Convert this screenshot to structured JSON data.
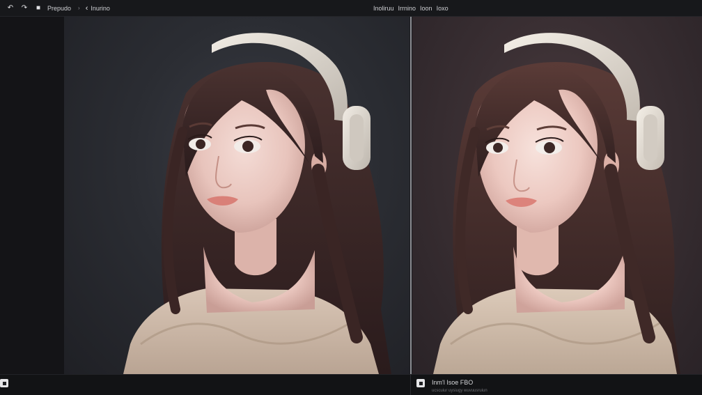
{
  "toolbar": {
    "left_label": "Prepudo",
    "separator": "›",
    "back_glyph": "‹",
    "crumb": "Inurino",
    "center_items": [
      "Inoliruu",
      "Irrnino",
      "Ioon",
      "Ioxo"
    ],
    "icons": [
      "undo-icon",
      "redo-icon",
      "layers-icon"
    ]
  },
  "statusbar": {
    "right_status": "Inm'l Isoe FBO",
    "right_sub": "ucscuiur uysiugy wuvuusruiun"
  },
  "panels": {
    "left_name": "original-image",
    "right_name": "edited-image"
  },
  "colors": {
    "left_background": "#2b2d33",
    "right_background": "#3a2f33",
    "divider": "#8c8d92"
  }
}
